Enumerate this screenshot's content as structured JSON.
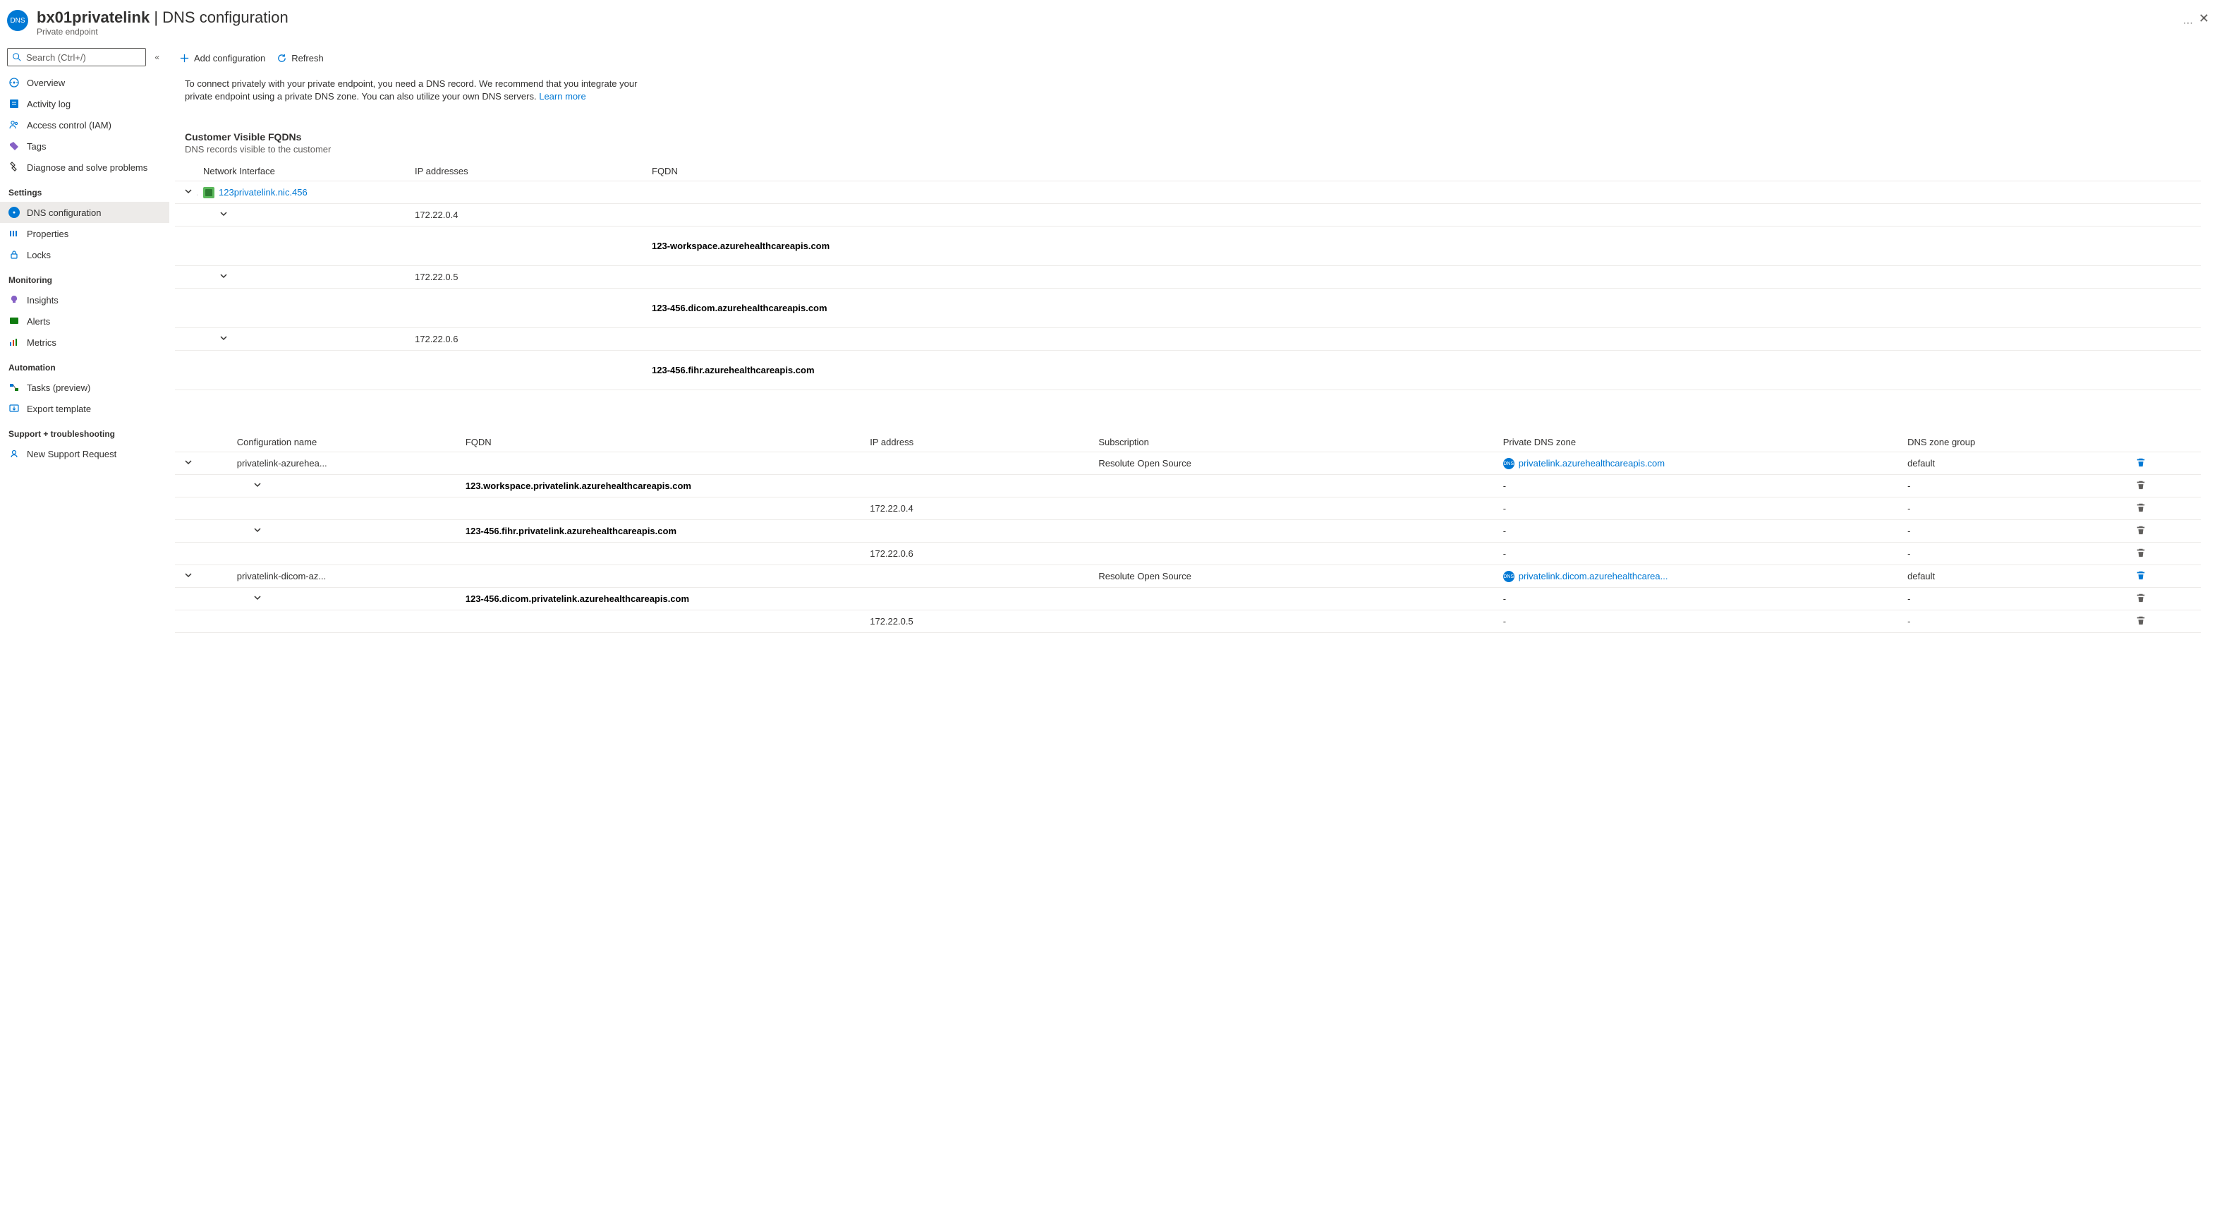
{
  "header": {
    "resource_name": "bx01privatelink",
    "page_title": "DNS configuration",
    "subtitle": "Private endpoint"
  },
  "search": {
    "placeholder": "Search (Ctrl+/)"
  },
  "nav": {
    "overview": "Overview",
    "activity": "Activity log",
    "iam": "Access control (IAM)",
    "tags": "Tags",
    "diagnose": "Diagnose and solve problems",
    "section_settings": "Settings",
    "dns": "DNS configuration",
    "properties": "Properties",
    "locks": "Locks",
    "section_monitoring": "Monitoring",
    "insights": "Insights",
    "alerts": "Alerts",
    "metrics": "Metrics",
    "section_automation": "Automation",
    "tasks": "Tasks (preview)",
    "export": "Export template",
    "section_support": "Support + troubleshooting",
    "support_request": "New Support Request"
  },
  "toolbar": {
    "add": "Add configuration",
    "refresh": "Refresh"
  },
  "description": {
    "text": "To connect privately with your private endpoint, you need a DNS record. We recommend that you integrate your private endpoint using a private DNS zone. You can also utilize your own DNS servers. ",
    "learn_more": "Learn more"
  },
  "fqdns": {
    "title": "Customer Visible FQDNs",
    "subtitle": "DNS records visible to the customer",
    "cols": {
      "nic": "Network Interface",
      "ip": "IP addresses",
      "fqdn": "FQDN"
    },
    "nic_link": "123privatelink.nic.456",
    "rows": [
      {
        "ip": "172.22.0.4",
        "fqdn": "123-workspace.azurehealthcareapis.com"
      },
      {
        "ip": "172.22.0.5",
        "fqdn": "123-456.dicom.azurehealthcareapis.com"
      },
      {
        "ip": "172.22.0.6",
        "fqdn": "123-456.fihr.azurehealthcareapis.com"
      }
    ]
  },
  "configs": {
    "cols": {
      "name": "Configuration name",
      "fqdn": "FQDN",
      "ip": "IP address",
      "sub": "Subscription",
      "zone": "Private DNS zone",
      "group": "DNS zone group"
    },
    "groups": [
      {
        "name": "privatelink-azurehea...",
        "subscription": "Resolute Open Source",
        "zone": "privatelink.azurehealthcareapis.com",
        "zone_group": "default",
        "rows": [
          {
            "fqdn": "123.workspace.privatelink.azurehealthcareapis.com",
            "ip": "172.22.0.4"
          },
          {
            "fqdn": "123-456.fihr.privatelink.azurehealthcareapis.com",
            "ip": "172.22.0.6"
          }
        ]
      },
      {
        "name": "privatelink-dicom-az...",
        "subscription": "Resolute Open Source",
        "zone": "privatelink.dicom.azurehealthcarea...",
        "zone_group": "default",
        "rows": [
          {
            "fqdn": "123-456.dicom.privatelink.azurehealthcareapis.com",
            "ip": "172.22.0.5"
          }
        ]
      }
    ],
    "dash": "-"
  }
}
